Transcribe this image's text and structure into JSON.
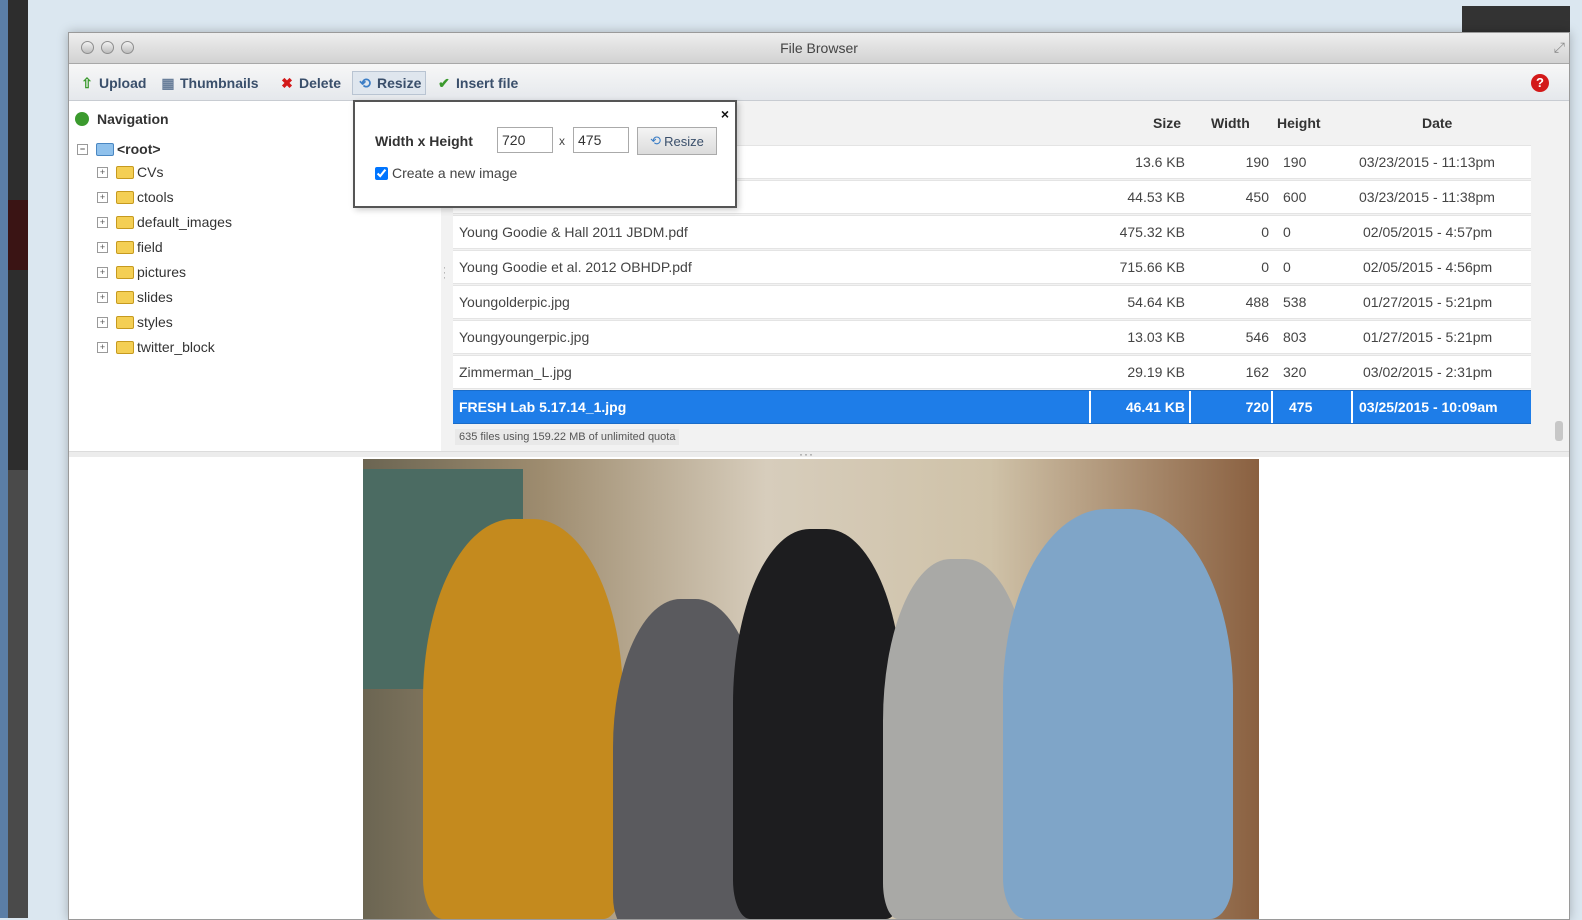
{
  "window": {
    "title": "File Browser"
  },
  "toolbar": {
    "upload": "Upload",
    "thumbnails": "Thumbnails",
    "delete": "Delete",
    "resize": "Resize",
    "insert": "Insert file",
    "help": "?"
  },
  "navigation": {
    "header": "Navigation",
    "root": "<root>",
    "folders": [
      "CVs",
      "ctools",
      "default_images",
      "field",
      "pictures",
      "slides",
      "styles",
      "twitter_block"
    ]
  },
  "columns": {
    "size": "Size",
    "width": "Width",
    "height": "Height",
    "date": "Date"
  },
  "files": [
    {
      "name": "",
      "size": "13.6 KB",
      "width": "190",
      "height": "190",
      "date": "03/23/2015 - 11:13pm"
    },
    {
      "name": "",
      "size": "44.53 KB",
      "width": "450",
      "height": "600",
      "date": "03/23/2015 - 11:38pm"
    },
    {
      "name": "Young Goodie & Hall 2011 JBDM.pdf",
      "size": "475.32 KB",
      "width": "0",
      "height": "0",
      "date": "02/05/2015 - 4:57pm"
    },
    {
      "name": "Young Goodie et al. 2012 OBHDP.pdf",
      "size": "715.66 KB",
      "width": "0",
      "height": "0",
      "date": "02/05/2015 - 4:56pm"
    },
    {
      "name": "Youngolderpic.jpg",
      "size": "54.64 KB",
      "width": "488",
      "height": "538",
      "date": "01/27/2015 - 5:21pm"
    },
    {
      "name": "Youngyoungerpic.jpg",
      "size": "13.03 KB",
      "width": "546",
      "height": "803",
      "date": "01/27/2015 - 5:21pm"
    },
    {
      "name": "Zimmerman_L.jpg",
      "size": "29.19 KB",
      "width": "162",
      "height": "320",
      "date": "03/02/2015 - 2:31pm"
    },
    {
      "name": "FRESH Lab 5.17.14_1.jpg",
      "size": "46.41 KB",
      "width": "720",
      "height": "475",
      "date": "03/25/2015 - 10:09am"
    }
  ],
  "status": "635 files using 159.22 MB of unlimited quota",
  "resize_popup": {
    "label": "Width x Height",
    "width_value": "720",
    "height_value": "475",
    "times": "x",
    "button": "Resize",
    "checkbox_label": "Create a new image",
    "close": "×"
  },
  "colors": {
    "selection": "#1e7de8",
    "help": "#d31919",
    "delete": "#d31919",
    "upload": "#3b9a2e"
  }
}
